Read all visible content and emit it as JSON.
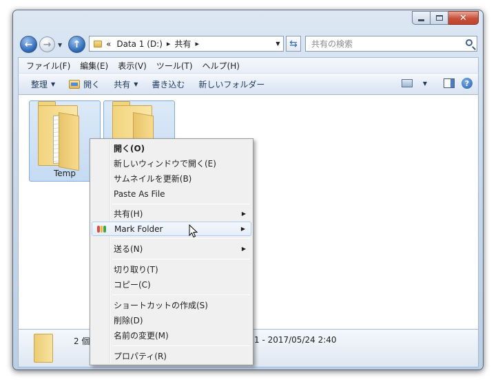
{
  "window": {
    "caption": {
      "minimize": "",
      "maximize": "",
      "close": "✕"
    }
  },
  "address": {
    "overflow": "«",
    "crumbs": [
      "Data 1 (D:)",
      "共有"
    ],
    "sep": "▸",
    "dropdown": "▼"
  },
  "search": {
    "placeholder": "共有の検索"
  },
  "menubar": {
    "items": [
      "ファイル(F)",
      "編集(E)",
      "表示(V)",
      "ツール(T)",
      "ヘルプ(H)"
    ]
  },
  "toolbar": {
    "organize": "整理",
    "open": "開く",
    "share": "共有",
    "burn": "書き込む",
    "new_folder": "新しいフォルダー",
    "arrow": "▼"
  },
  "files": [
    {
      "name": "Temp",
      "selected": true
    },
    {
      "name": "",
      "selected": true
    }
  ],
  "details": {
    "count": "2 個",
    "date": "1 - 2017/05/24 2:40"
  },
  "context_menu": {
    "items": [
      {
        "label": "開く(O)",
        "bold": true
      },
      {
        "label": "新しいウィンドウで開く(E)"
      },
      {
        "label": "サムネイルを更新(B)"
      },
      {
        "label": "Paste As File"
      },
      {
        "label": "共有(H)",
        "submenu": true
      },
      {
        "label": "Mark Folder",
        "submenu": true,
        "highlighted": true
      },
      {
        "label": "送る(N)",
        "submenu": true
      },
      {
        "label": "切り取り(T)"
      },
      {
        "label": "コピー(C)"
      },
      {
        "label": "ショートカットの作成(S)"
      },
      {
        "label": "削除(D)"
      },
      {
        "label": "名前の変更(M)"
      },
      {
        "label": "プロパティ(R)"
      }
    ],
    "submenu_arrow": "▶",
    "mark_icon_colors": [
      "#e04b3a",
      "#f2b632",
      "#3aa64b"
    ]
  },
  "help": "?"
}
